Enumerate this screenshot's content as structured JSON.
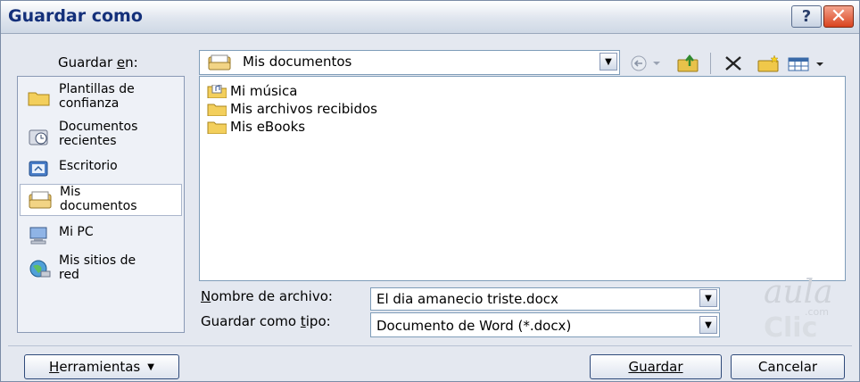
{
  "title": "Guardar como",
  "titlebar": {
    "help": "?",
    "close": "✕"
  },
  "save_in": {
    "label_pre": "Guardar ",
    "label_key": "e",
    "label_post": "n:",
    "value": "Mis documentos"
  },
  "places": [
    {
      "line1": "Plantillas de",
      "line2": "confianza",
      "icon": "folder-icon"
    },
    {
      "line1": "Documentos",
      "line2": "recientes",
      "icon": "recent-documents-icon"
    },
    {
      "line1": "Escritorio",
      "line2": "",
      "icon": "desktop-icon"
    },
    {
      "line1": "Mis",
      "line2": "documentos",
      "icon": "my-documents-icon"
    },
    {
      "line1": "Mi PC",
      "line2": "",
      "icon": "my-computer-icon"
    },
    {
      "line1": "Mis sitios de",
      "line2": "red",
      "icon": "network-places-icon"
    }
  ],
  "files": [
    {
      "name": "Mi música",
      "icon": "music-folder-icon"
    },
    {
      "name": "Mis archivos recibidos",
      "icon": "folder-icon"
    },
    {
      "name": "Mis eBooks",
      "icon": "folder-icon"
    }
  ],
  "filename": {
    "label_key": "N",
    "label_post": "ombre de archivo:",
    "value": "El dia amanecio triste.docx"
  },
  "filetype": {
    "label_pre": "Guardar como ",
    "label_key": "t",
    "label_post": "ipo:",
    "value": "Documento de Word (*.docx)"
  },
  "buttons": {
    "tools_key": "H",
    "tools_post": "erramientas",
    "save_key": "G",
    "save_post": "uardar",
    "cancel": "Cancelar"
  },
  "watermark": {
    "top": "aula",
    "com": ".com",
    "bottom": "Clic"
  },
  "colors": {
    "title_text": "#14307a",
    "dialog_bg": "#e4e8f0",
    "close_button": "#d9431f"
  }
}
